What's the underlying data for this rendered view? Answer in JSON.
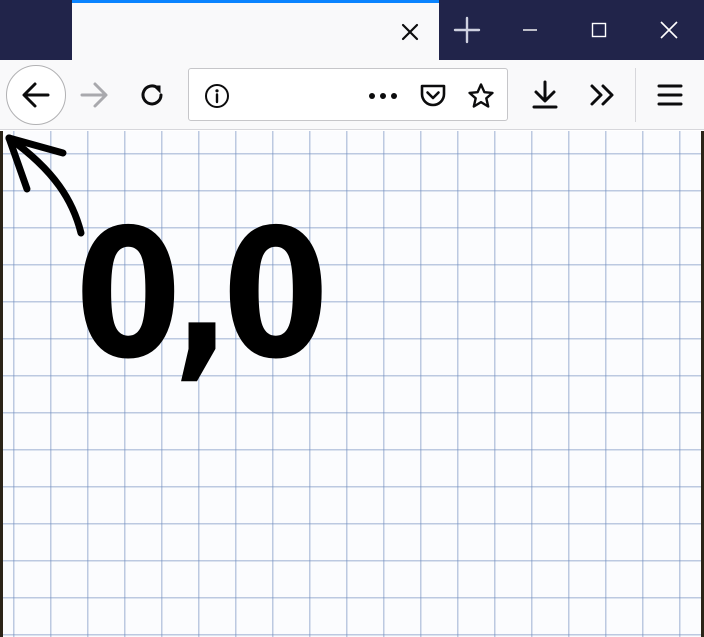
{
  "tab": {
    "title": ""
  },
  "urlbar": {
    "value": "",
    "placeholder": ""
  },
  "icons": {
    "tab_close": "close-icon",
    "new_tab": "plus-icon",
    "minimize": "minimize-icon",
    "maximize": "maximize-icon",
    "close_window": "close-icon",
    "back": "arrow-left-icon",
    "forward": "arrow-right-icon",
    "reload": "reload-icon",
    "site_info": "info-icon",
    "page_actions": "more-horizontal-icon",
    "pocket": "pocket-icon",
    "bookmark": "star-icon",
    "downloads": "download-icon",
    "overflow": "chevrons-right-icon",
    "menu": "hamburger-menu-icon",
    "annotation_arrow": "hand-drawn-arrow-icon"
  },
  "colors": {
    "titlebar": "#21244a",
    "tab_accent": "#0a84ff",
    "toolbar": "#f9f9fa",
    "grid_line": "#6e8cbe",
    "annotation": "#000000"
  },
  "content": {
    "annotation_text": "0,0"
  }
}
